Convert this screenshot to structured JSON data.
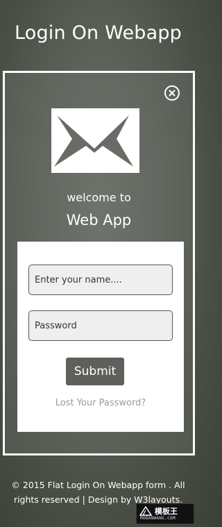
{
  "header": {
    "title": "Login On Webapp"
  },
  "login": {
    "close_icon": "close-circle-icon",
    "mail_icon": "envelope-icon",
    "welcome_text": "welcome to",
    "app_name": "Web App",
    "form": {
      "name_placeholder": "Enter your name....",
      "password_placeholder": "Password",
      "submit_label": "Submit",
      "lost_password_label": "Lost Your Password?"
    }
  },
  "footer": {
    "text": "© 2015 Flat Login On Webapp form . All rights reserved | Design by W3layouts."
  },
  "watermark": {
    "text": "模板王",
    "subtext": "MOBANWANG.COM"
  },
  "colors": {
    "background": "#5d6259",
    "frame_border": "#ffffff",
    "submit_background": "#5f605c",
    "input_background": "#efefef",
    "link_color": "#9a9a9a"
  }
}
